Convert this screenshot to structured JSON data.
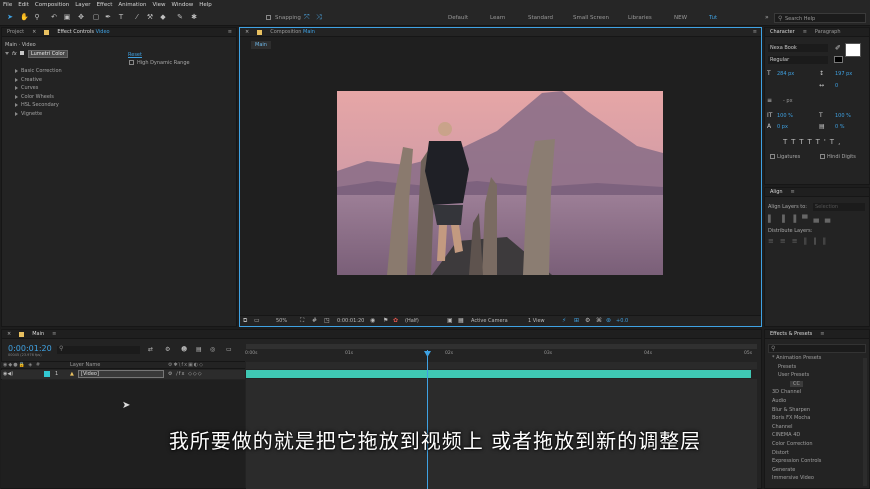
{
  "menu": [
    "File",
    "Edit",
    "Composition",
    "Layer",
    "Effect",
    "Animation",
    "View",
    "Window",
    "Help"
  ],
  "toolbar": {
    "snapping": "Snapping"
  },
  "workspaces": [
    {
      "label": "Default",
      "active": false
    },
    {
      "label": "Learn",
      "active": false
    },
    {
      "label": "Standard",
      "active": false
    },
    {
      "label": "Small Screen",
      "active": false
    },
    {
      "label": "Libraries",
      "active": false
    },
    {
      "label": "NEW",
      "active": false
    },
    {
      "label": "Tut",
      "active": true
    }
  ],
  "search_help": "Search Help",
  "left_panel": {
    "tab_project": "Project",
    "tab_effect_controls": "Effect Controls",
    "effect_layer": "Video",
    "layer_path": "Main · Video",
    "fx_label": "fx",
    "effect_name": "Lumetri Color",
    "reset": "Reset",
    "hdr": "High Dynamic Range",
    "sections": [
      "Basic Correction",
      "Creative",
      "Curves",
      "Color Wheels",
      "HSL Secondary",
      "Vignette"
    ]
  },
  "comp_panel": {
    "tab": "Composition",
    "comp_name": "Main",
    "sub_tab": "Main",
    "zoom": "50%",
    "timecode": "0:00:01:20",
    "resolution": "(Half)",
    "camera": "Active Camera",
    "view": "1 View",
    "exposure": "+0.0"
  },
  "character": {
    "tab": "Character",
    "tab2": "Paragraph",
    "font": "Nexa Book",
    "style": "Regular",
    "size": "284 px",
    "leading": "197 px",
    "tracking": "0",
    "stroke": "- px",
    "vscale": "100 %",
    "hscale": "100 %",
    "baseline": "0 px",
    "tsume": "0 %",
    "ligatures": "Ligatures",
    "hindi": "Hindi Digits"
  },
  "align": {
    "tab": "Align",
    "align_to": "Align Layers to:",
    "align_to_value": "Selection",
    "distribute": "Distribute Layers:"
  },
  "effects": {
    "tab": "Effects & Presets",
    "search": "",
    "items": [
      "* Animation Presets",
      "Presets",
      "User Presets",
      "CC",
      "3D Channel",
      "Audio",
      "Blur & Sharpen",
      "Boris FX Mocha",
      "Channel",
      "CINEMA 4D",
      "Color Correction",
      "Distort",
      "Expression Controls",
      "Generate",
      "Immersive Video"
    ]
  },
  "timeline": {
    "tab": "Main",
    "timecode": "0:00:01:20",
    "fps": "00045 (23.976 fps)",
    "col_layer_name": "Layer Name",
    "layer_index": "1",
    "layer_name": "[Video]",
    "ticks": [
      "0:00s",
      "01s",
      "02s",
      "03s",
      "04s",
      "05s"
    ]
  },
  "subtitle": "我所要做的就是把它拖放到视频上 或者拖放到新的调整层",
  "colors": {
    "accent": "#3fa2e3",
    "track": "#3fc8b4",
    "swatch": "#32c8d2"
  }
}
